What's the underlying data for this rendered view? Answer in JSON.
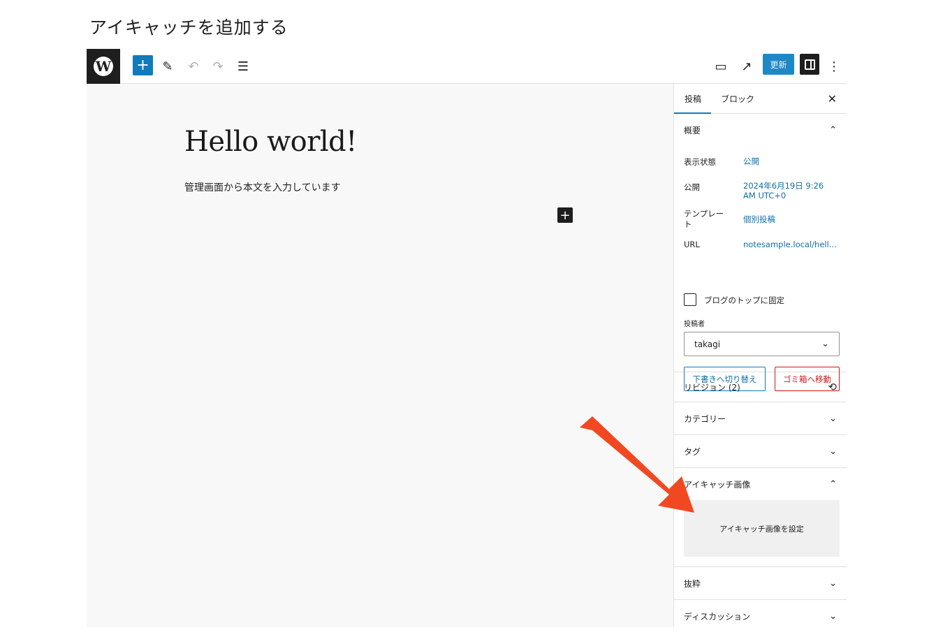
{
  "page": {
    "heading": "アイキャッチを追加する"
  },
  "toolbar": {
    "logo": "W",
    "add_block_icon": "+",
    "edit_icon": "✎",
    "undo_icon": "↶",
    "redo_icon": "↷",
    "list_view_icon": "☰",
    "preview_icon": "▭",
    "view_post_icon": "↗",
    "update_label": "更新",
    "more_icon": "⋮"
  },
  "post": {
    "title": "Hello world!",
    "body": "管理画面から本文を入力しています",
    "inline_add_icon": "+"
  },
  "sidebar": {
    "tabs": {
      "post": "投稿",
      "block": "ブロック",
      "close_icon": "✕"
    },
    "summary": {
      "title": "概要",
      "visibility_label": "表示状態",
      "visibility_value": "公開",
      "publish_label": "公開",
      "publish_value_line1": "2024年6月19日 9:26",
      "publish_value_line2": "AM UTC+0",
      "template_label_line1": "テンプレー",
      "template_label_line2": "ト",
      "template_value": "個別投稿",
      "url_label": "URL",
      "url_value": "notesample.local/hell...",
      "sticky_label": "ブログのトップに固定",
      "author_label": "投稿者",
      "author_value": "takagi",
      "switch_draft_label": "下書きへ切り替え",
      "trash_label": "ゴミ箱へ移動"
    },
    "revisions_label": "リビジョン (2)",
    "revisions_icon": "⟲",
    "categories_label": "カテゴリー",
    "tags_label": "タグ",
    "featured_image": {
      "title": "アイキャッチ画像",
      "set_label": "アイキャッチ画像を設定"
    },
    "excerpt_label": "抜粋",
    "discussion_label": "ディスカッション",
    "chevron_up": "⌃",
    "chevron_down": "⌄"
  },
  "colors": {
    "accent": "#0f7bbd",
    "danger": "#cc1818",
    "annotation_arrow": "#f24822"
  }
}
